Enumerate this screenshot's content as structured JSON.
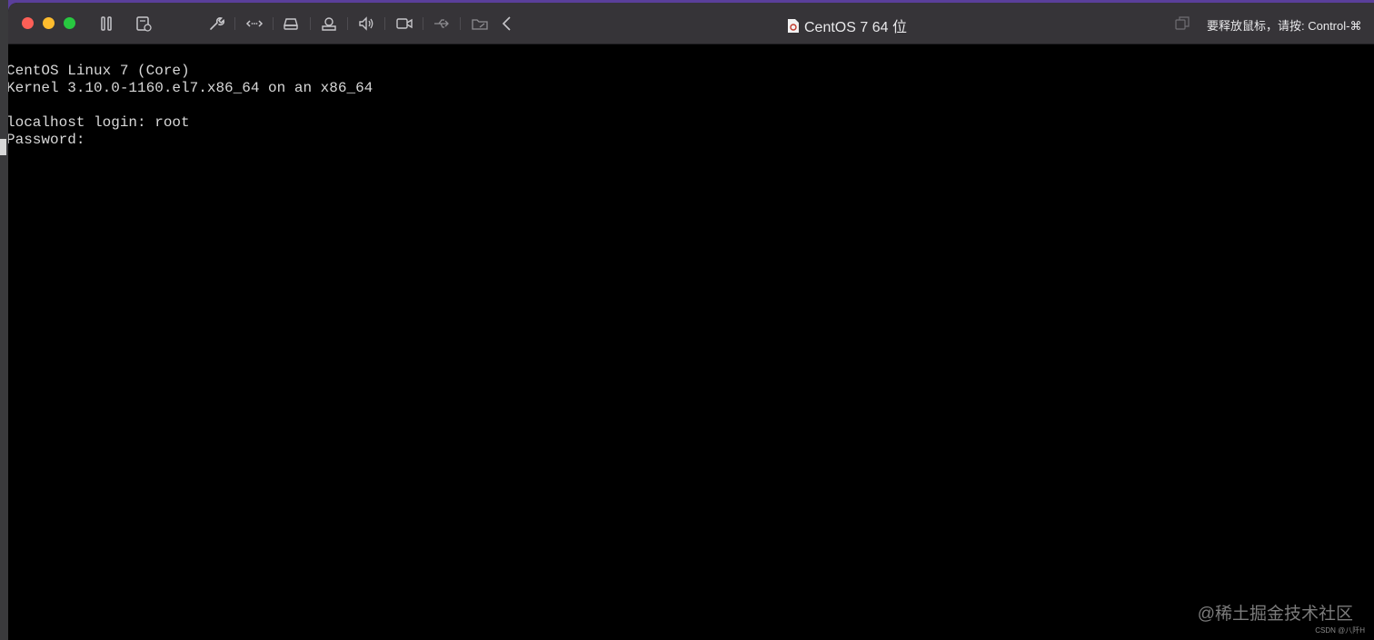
{
  "window": {
    "title": "CentOS 7 64 位",
    "release_hint": "要释放鼠标，请按: Control-⌘"
  },
  "toolbar": {
    "icons": [
      "pause-icon",
      "snapshot-icon",
      "settings-wrench-icon",
      "network-icon",
      "harddisk-icon",
      "printer-icon",
      "sound-icon",
      "camera-icon",
      "usb-icon",
      "shared-folder-icon",
      "back-chevron-icon"
    ]
  },
  "console": {
    "lines": [
      "CentOS Linux 7 (Core)",
      "Kernel 3.10.0-1160.el7.x86_64 on an x86_64",
      "",
      "localhost login: root",
      "Password:"
    ]
  },
  "watermark": {
    "main": "@稀土掘金技术社区",
    "small": "CSDN @八阡H"
  },
  "colors": {
    "titlebar": "#363438",
    "console_bg": "#000000",
    "console_text": "#d8d8d8",
    "desktop": "#5a3f9a"
  }
}
